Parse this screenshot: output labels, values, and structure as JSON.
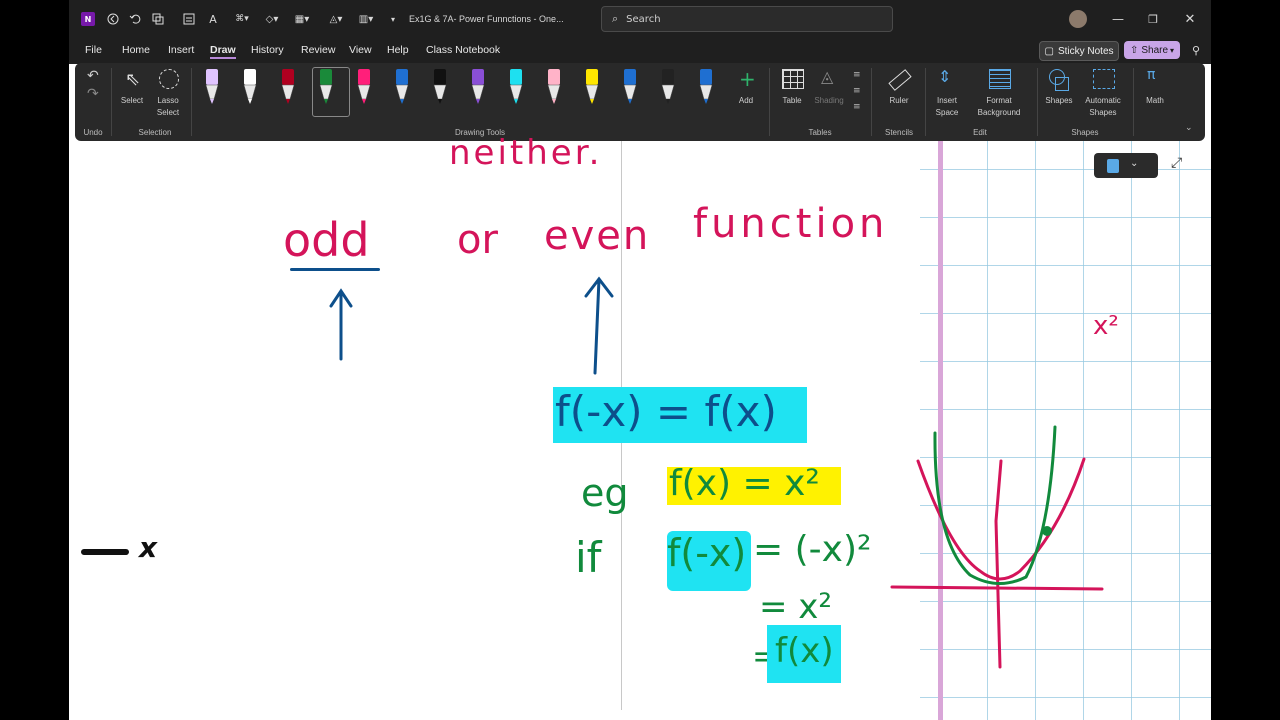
{
  "window": {
    "title": "Ex1G & 7A- Power Funnctions - One...",
    "search_placeholder": "Search"
  },
  "menu": {
    "items": [
      "File",
      "Home",
      "Insert",
      "Draw",
      "History",
      "Review",
      "View",
      "Help",
      "Class Notebook"
    ],
    "active": "Draw",
    "sticky_notes": "Sticky Notes",
    "share": "Share"
  },
  "ribbon": {
    "undo_group": "Undo",
    "select": "Select",
    "lasso": "Lasso",
    "lasso2": "Select",
    "selection_group": "Selection",
    "drawing_tools_group": "Drawing Tools",
    "add": "Add",
    "table": "Table",
    "shading": "Shading",
    "tables_group": "Tables",
    "ruler": "Ruler",
    "stencils_group": "Stencils",
    "insert": "Insert",
    "space": "Space",
    "format": "Format",
    "background": "Background",
    "edit_group": "Edit",
    "shapes": "Shapes",
    "automatic": "Automatic",
    "shapes2": "Shapes",
    "shapes_group": "Shapes",
    "math": "Math",
    "pen_colors": [
      "#e0c4ff",
      "#ffffff",
      "#b00020",
      "#1a8a3a",
      "#ff1f7a",
      "#1f6fd1",
      "#111111",
      "#8a4fd6",
      "#1ee0f0",
      "#ffb3c8",
      "#ffe600",
      "#1f6fd1",
      "#222222",
      "#1f6fd1"
    ]
  },
  "notes": {
    "neither": "neither.",
    "odd": "odd",
    "or": "or",
    "even": "even",
    "function": "function",
    "f_eq": "f(-x) = f(x)",
    "eg": "eg",
    "eg_expr": "f(x) = x²",
    "if": "if",
    "if_lhs": "f(-x)",
    "if_rhs": "= (-x)²",
    "step2": "= x²",
    "step3_eq": "=",
    "step3": "f(x)",
    "left_x": "x",
    "graph_label": "x²"
  },
  "colors": {
    "pink": "#d4145a",
    "blue": "#0d4f8b",
    "green": "#118a3c",
    "cyan": "#1fe3f2",
    "yellow": "#fff200"
  }
}
